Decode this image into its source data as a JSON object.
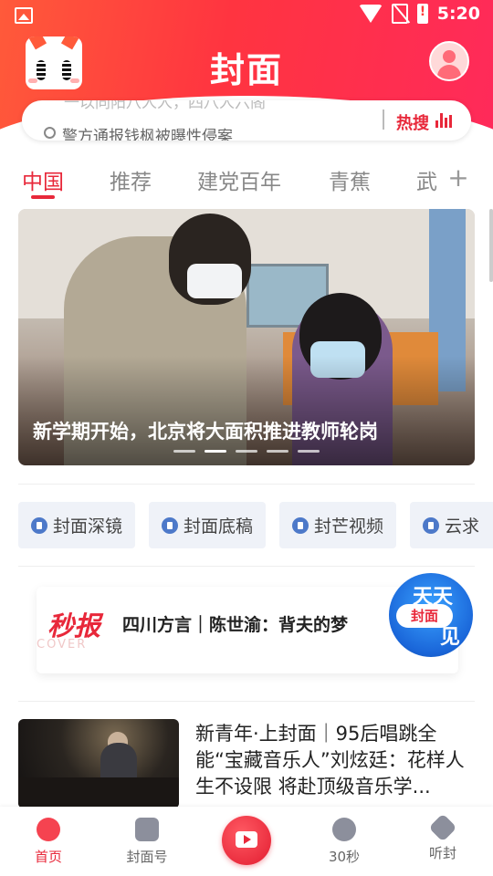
{
  "status": {
    "time": "5:20"
  },
  "header": {
    "title": "封面"
  },
  "search": {
    "ghost_text": "一以同阳八人人，四八人六阁",
    "query": "警方通报钱枫被曝性侵案",
    "hot_label": "热搜"
  },
  "tabs": [
    {
      "label": "中国",
      "active": true
    },
    {
      "label": "推荐",
      "active": false
    },
    {
      "label": "建党百年",
      "active": false
    },
    {
      "label": "青蕉",
      "active": false
    },
    {
      "label": "武",
      "active": false
    }
  ],
  "tab_add": "+",
  "banner": {
    "caption": "新学期开始，北京将大面积推进教师轮岗",
    "page_index": 2,
    "page_count": 5
  },
  "chips": [
    {
      "label": "封面深镜",
      "icon": "lens-icon"
    },
    {
      "label": "封面底稿",
      "icon": "draft-icon"
    },
    {
      "label": "封芒视频",
      "icon": "video-icon"
    },
    {
      "label": "云求",
      "icon": "send-icon"
    }
  ],
  "card": {
    "logo": "秒报",
    "logo_sub": "COVER",
    "title": "四川方言｜陈世渝：背夫的梦",
    "badge_top": "天天",
    "badge_mid": "封面",
    "badge_bot": "见"
  },
  "news": {
    "title": "新青年·上封面｜95后唱跳全能“宝藏音乐人”刘炫廷：花样人生不设限 将赴顶级音乐学..."
  },
  "bottom_nav": [
    {
      "label": "首页",
      "icon": "home-icon",
      "active": true
    },
    {
      "label": "封面号",
      "icon": "bookmark-icon",
      "active": false
    },
    {
      "label": "",
      "icon": "tv-play-icon",
      "active": false
    },
    {
      "label": "30秒",
      "icon": "30s-icon",
      "active": false
    },
    {
      "label": "听封",
      "icon": "audio-icon",
      "active": false
    }
  ],
  "colors": {
    "brand": "#e8283a",
    "header_start": "#ff5a3a",
    "header_end": "#ff2a5a"
  }
}
